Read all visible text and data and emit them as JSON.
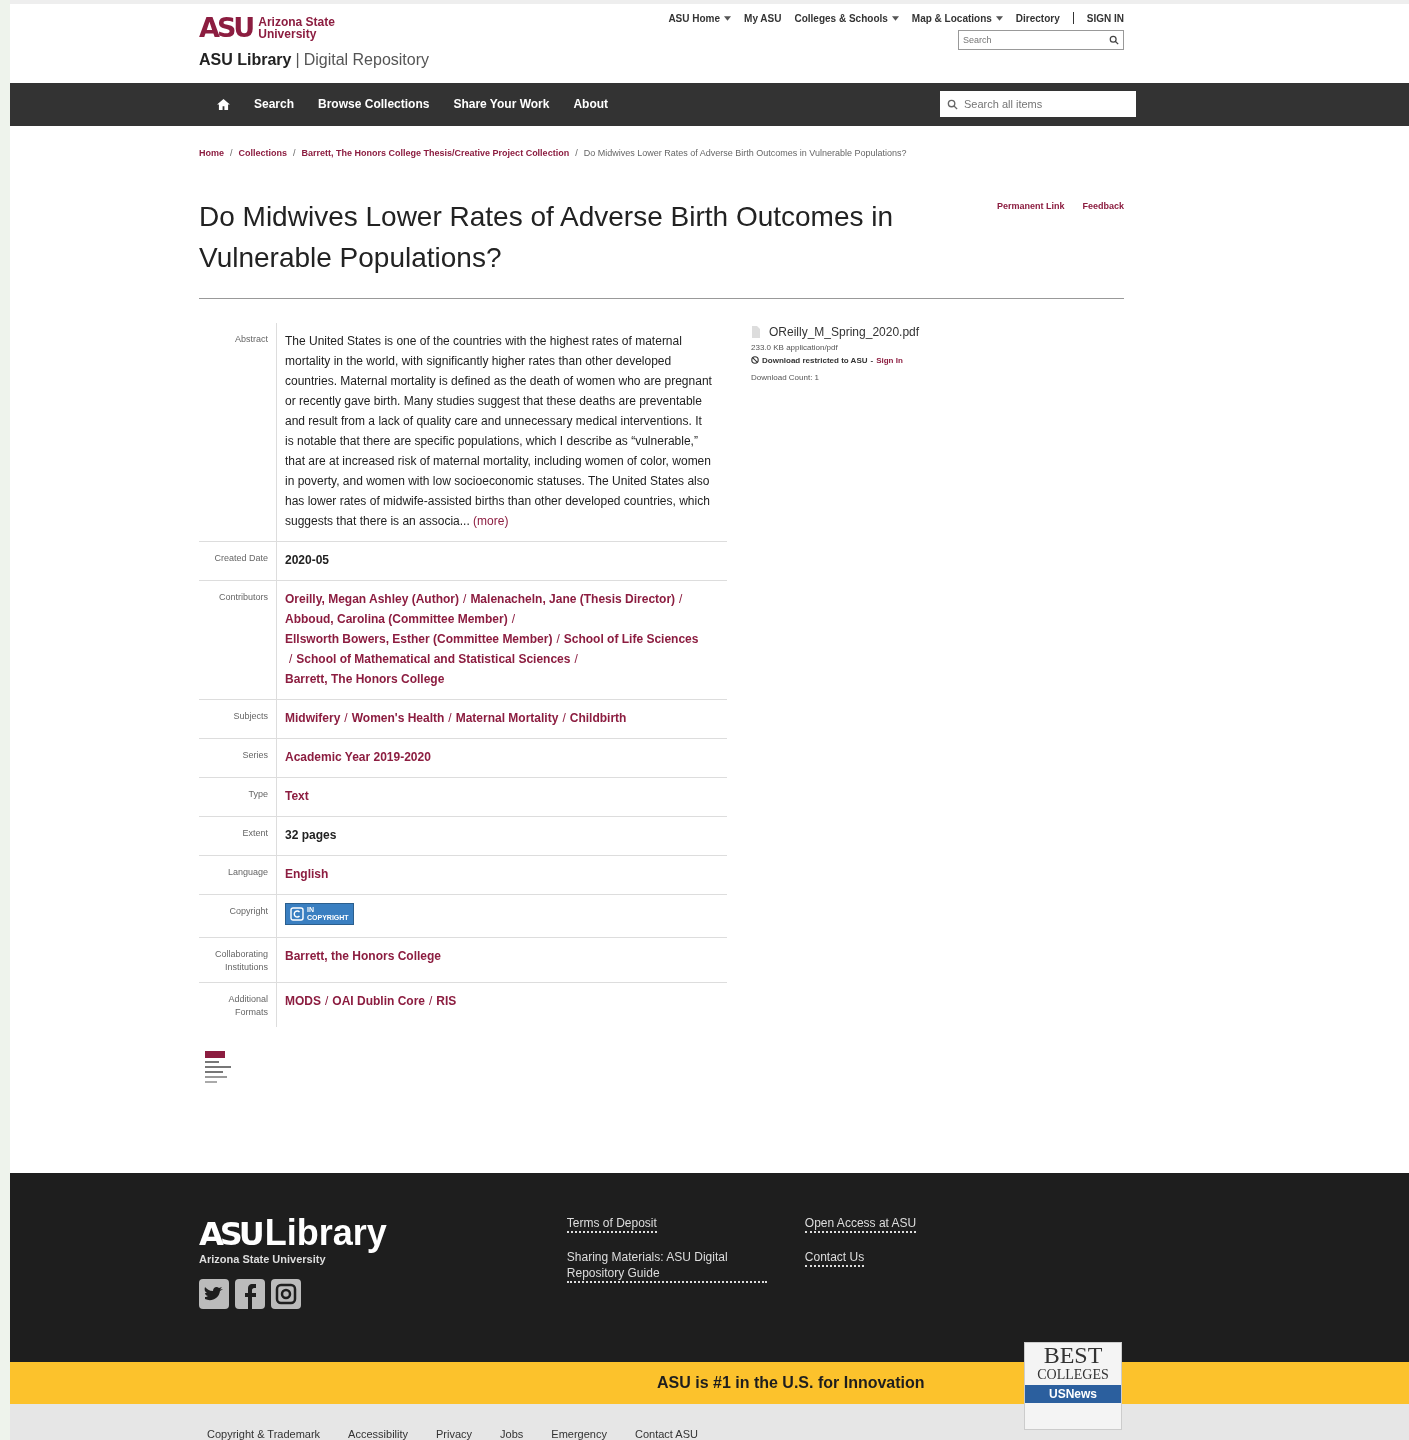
{
  "header": {
    "logo_mark": "ASU",
    "logo_name": [
      "Arizona State",
      "University"
    ],
    "site_title": "ASU Library",
    "site_divider": "|",
    "site_subtitle": "Digital Repository",
    "top_links": [
      {
        "label": "ASU Home",
        "dropdown": true
      },
      {
        "label": "My ASU",
        "dropdown": false
      },
      {
        "label": "Colleges & Schools",
        "dropdown": true
      },
      {
        "label": "Map & Locations",
        "dropdown": true
      },
      {
        "label": "Directory",
        "dropdown": false
      },
      {
        "label": "SIGN IN",
        "dropdown": false
      }
    ],
    "search": {
      "placeholder": "Search"
    }
  },
  "nav": {
    "items": [
      "Search",
      "Browse Collections",
      "Share Your Work",
      "About"
    ],
    "search": {
      "placeholder": "Search all items"
    }
  },
  "breadcrumb_separator": "/",
  "link_separator": "/",
  "breadcrumb": [
    {
      "label": "Home",
      "link": true
    },
    {
      "label": "Collections",
      "link": true
    },
    {
      "label": "Barrett, The Honors College Thesis/Creative Project Collection",
      "link": true
    },
    {
      "label": "Do Midwives Lower Rates of Adverse Birth Outcomes in Vulnerable Populations?",
      "link": false
    }
  ],
  "title": "Do Midwives Lower Rates of Adverse Birth Outcomes in Vulnerable Populations?",
  "actions": [
    "Permanent Link",
    "Feedback"
  ],
  "metadata": [
    {
      "label": "Abstract",
      "kind": "abstract",
      "text": "The United States is one of the countries with the highest rates of maternal mortality in the world, with significantly higher rates than other developed countries. Maternal mortality is defined as the death of women who are pregnant or recently gave birth. Many studies suggest that these deaths are preventable and result from a lack of quality care and unnecessary medical interventions. It is notable that there are specific populations, which I describe as “vulnerable,” that are at increased risk of maternal mortality, including women of color, women in poverty, and women with low socioeconomic statuses. The United States also has lower rates of midwife-assisted births than other developed countries, which suggests that there is an associa...",
      "more": "(more)"
    },
    {
      "label": "Created Date",
      "kind": "text",
      "text": "2020-05"
    },
    {
      "label": "Contributors",
      "kind": "links",
      "links": [
        "Oreilly, Megan Ashley (Author)",
        "Malenacheln, Jane (Thesis Director)",
        "Abboud, Carolina (Committee Member)",
        "Ellsworth Bowers, Esther (Committee Member)",
        "School of Life Sciences",
        "School of Mathematical and Statistical Sciences",
        "Barrett, The Honors College"
      ]
    },
    {
      "label": "Subjects",
      "kind": "links",
      "links": [
        "Midwifery",
        "Women's Health",
        "Maternal Mortality",
        "Childbirth"
      ]
    },
    {
      "label": "Series",
      "kind": "links",
      "links": [
        "Academic Year 2019-2020"
      ]
    },
    {
      "label": "Type",
      "kind": "links",
      "links": [
        "Text"
      ]
    },
    {
      "label": "Extent",
      "kind": "text",
      "text": "32 pages"
    },
    {
      "label": "Language",
      "kind": "links",
      "links": [
        "English"
      ]
    },
    {
      "label": "Copyright",
      "kind": "badge",
      "badge": [
        "IN",
        "COPYRIGHT"
      ]
    },
    {
      "label": "Collaborating Institutions",
      "kind": "links",
      "links": [
        "Barrett, the Honors College"
      ]
    },
    {
      "label": "Additional Formats",
      "kind": "links",
      "links": [
        "MODS",
        "OAI Dublin Core",
        "RIS"
      ]
    }
  ],
  "file": {
    "name": "OReilly_M_Spring_2020.pdf",
    "info": "233.0 KB application/pdf",
    "restriction": "Download restricted to ASU",
    "separator": "-",
    "sign_in": "Sign In",
    "count": "Download Count: 1"
  },
  "footer": {
    "logo_mark": "ASU",
    "logo_word": "Library",
    "logo_sub": "Arizona State University",
    "links": [
      "Terms of Deposit",
      "Sharing Materials: ASU Digital Repository Guide",
      "Open Access at ASU",
      "Contact Us"
    ],
    "banner": "ASU is #1 in the U.S. for Innovation",
    "badge": [
      "BEST",
      "COLLEGES",
      "USNews"
    ],
    "bottom_links": [
      "Copyright & Trademark",
      "Accessibility",
      "Privacy",
      "Jobs",
      "Emergency",
      "Contact ASU"
    ]
  }
}
